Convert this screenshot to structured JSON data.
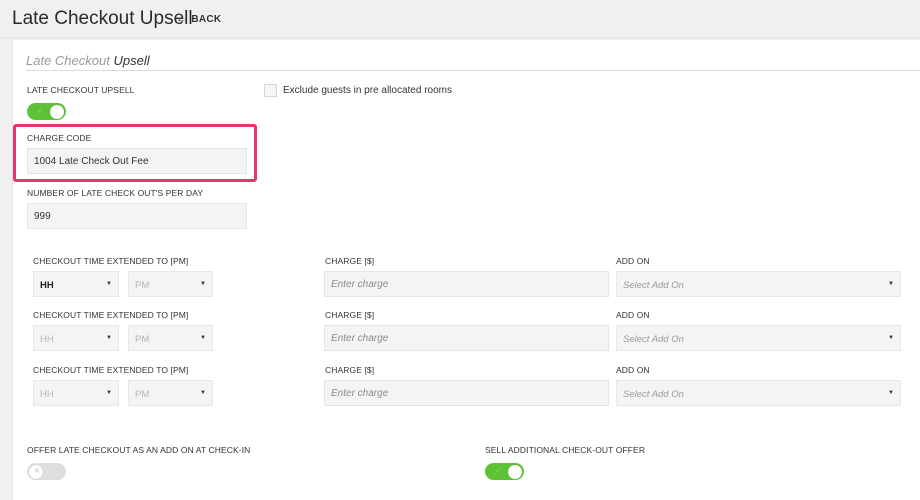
{
  "header": {
    "title": "Late Checkout Upsell",
    "back_label": "BACK"
  },
  "section": {
    "title_light": "Late Checkout",
    "title_dark": "Upsell"
  },
  "upsell_toggle": {
    "label": "LATE CHECKOUT UPSELL",
    "on": true
  },
  "exclude": {
    "label": "Exclude guests in pre allocated rooms",
    "checked": false
  },
  "charge_code": {
    "label": "CHARGE CODE",
    "value": "1004 Late Check Out Fee"
  },
  "per_day": {
    "label": "NUMBER OF LATE CHECK OUT'S PER DAY",
    "value": "999"
  },
  "extensions": [
    {
      "time_label": "CHECKOUT TIME EXTENDED TO [PM]",
      "hour": "HH",
      "ampm": "PM",
      "charge_label": "CHARGE [$]",
      "charge_placeholder": "Enter charge",
      "addon_label": "ADD ON",
      "addon_value": "Select Add On"
    },
    {
      "time_label": "CHECKOUT TIME EXTENDED TO [PM]",
      "hour": "HH",
      "ampm": "PM",
      "charge_label": "CHARGE [$]",
      "charge_placeholder": "Enter charge",
      "addon_label": "ADD ON",
      "addon_value": "Select Add On"
    },
    {
      "time_label": "CHECKOUT TIME EXTENDED TO [PM]",
      "hour": "HH",
      "ampm": "PM",
      "charge_label": "CHARGE [$]",
      "charge_placeholder": "Enter charge",
      "addon_label": "ADD ON",
      "addon_value": "Select Add On"
    }
  ],
  "offer_checkin": {
    "label": "OFFER LATE CHECKOUT AS AN ADD ON AT CHECK-IN",
    "on": false
  },
  "sell_additional": {
    "label": "SELL ADDITIONAL CHECK-OUT OFFER",
    "on": true
  },
  "colors": {
    "toggle_on": "#5ec237",
    "highlight": "#e8356a"
  }
}
